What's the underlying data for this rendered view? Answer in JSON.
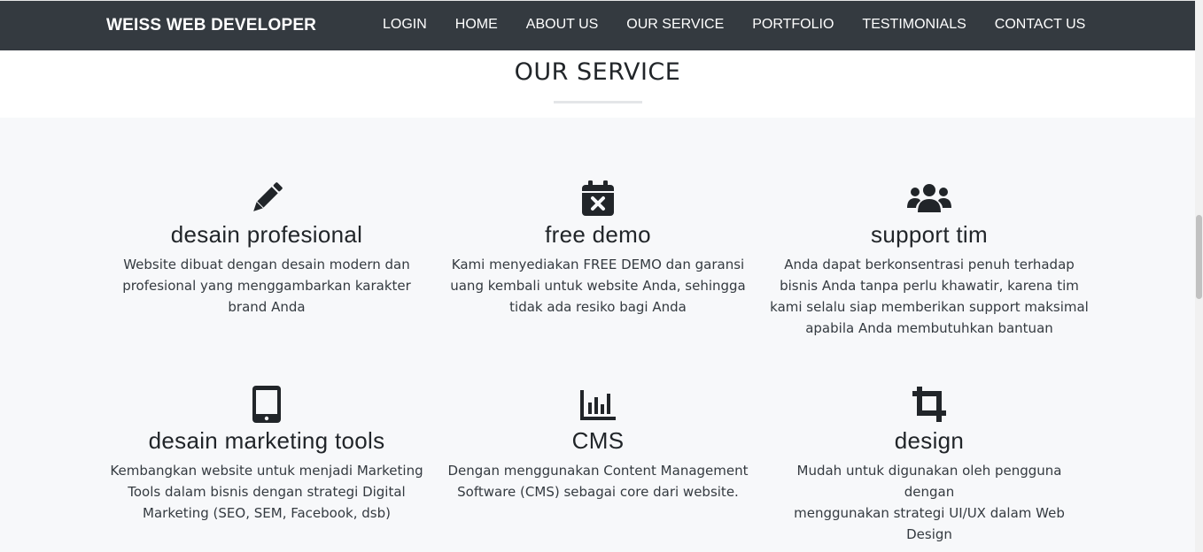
{
  "navbar": {
    "brand": "WEISS WEB DEVELOPER",
    "items": [
      "LOGIN",
      "HOME",
      "ABOUT US",
      "OUR SERVICE",
      "PORTFOLIO",
      "TESTIMONIALS",
      "CONTACT US"
    ]
  },
  "section": {
    "title": "OUR SERVICE"
  },
  "services": [
    {
      "icon": "pencil-icon",
      "title": "desain profesional",
      "lines": [
        "Website dibuat dengan desain modern dan",
        "profesional yang menggambarkan karakter",
        "brand Anda"
      ]
    },
    {
      "icon": "calendar-x-icon",
      "title": "free demo",
      "lines": [
        "Kami menyediakan FREE DEMO dan garansi",
        "uang kembali untuk website Anda, sehingga",
        "tidak ada resiko bagi Anda"
      ]
    },
    {
      "icon": "users-icon",
      "title": "support tim",
      "lines": [
        "Anda dapat berkonsentrasi penuh terhadap",
        "bisnis Anda tanpa perlu khawatir, karena tim",
        "kami selalu siap memberikan support maksimal",
        "apabila Anda membutuhkan bantuan"
      ]
    },
    {
      "icon": "tablet-icon",
      "title": "desain marketing tools",
      "lines": [
        "Kembangkan website untuk menjadi Marketing",
        "Tools dalam bisnis dengan strategi Digital",
        "Marketing (SEO, SEM, Facebook, dsb)"
      ]
    },
    {
      "icon": "chart-bar-icon",
      "title": "CMS",
      "lines": [
        "Dengan menggunakan Content Management",
        "Software (CMS) sebagai core dari website."
      ]
    },
    {
      "icon": "crop-icon",
      "title": "design",
      "lines": [
        "Mudah untuk digunakan oleh pengguna dengan",
        "menggunakan strategi UI/UX dalam Web Design"
      ]
    }
  ]
}
